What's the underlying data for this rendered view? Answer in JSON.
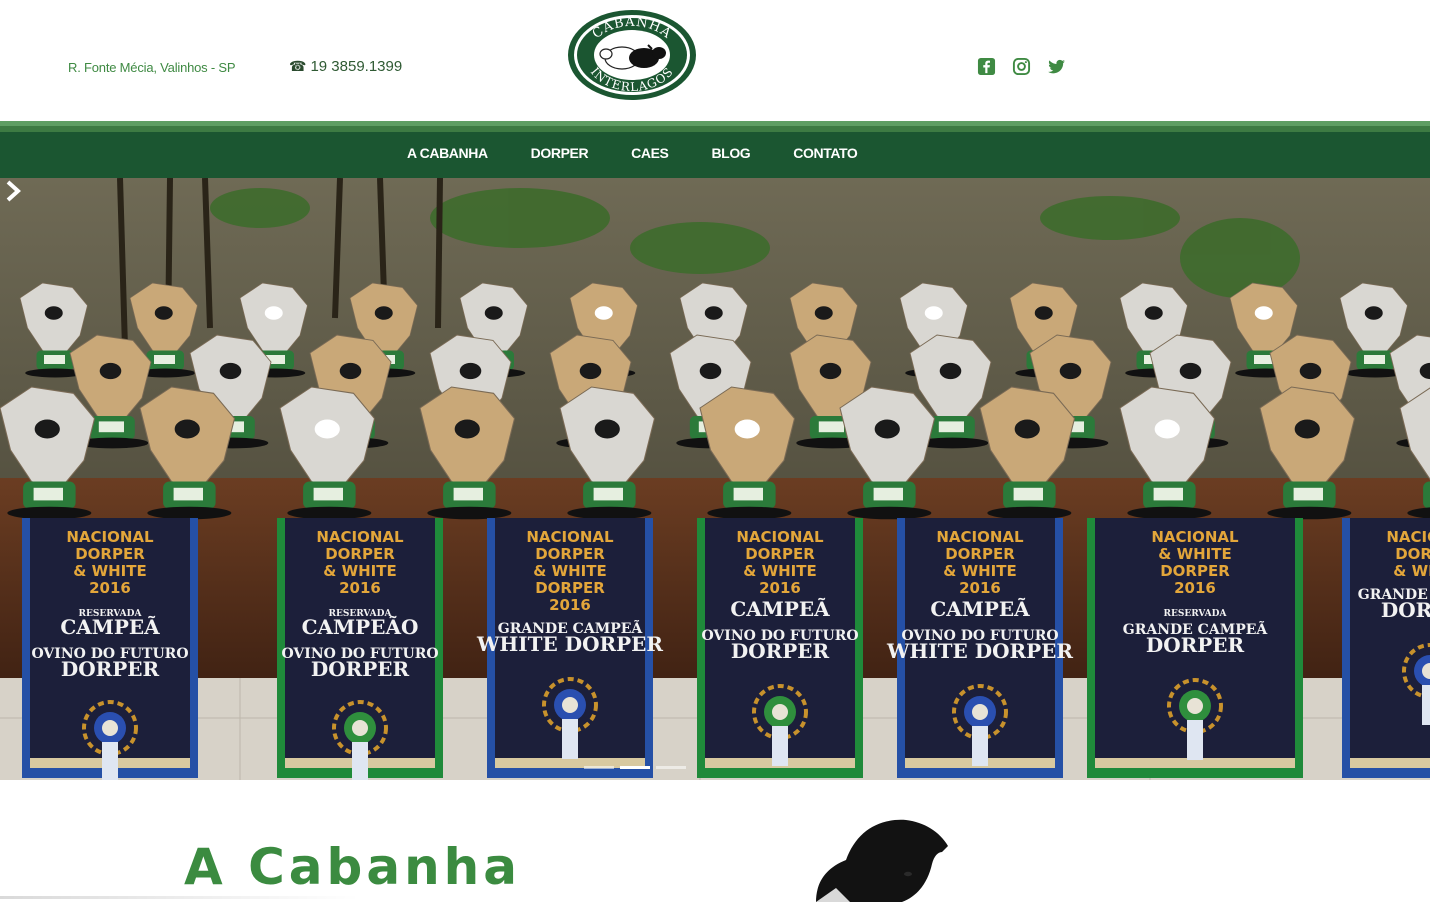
{
  "header": {
    "address": "R. Fonte Mécia, Valinhos - SP",
    "phone": "19 3859.1399",
    "phone_icon": "phone-icon",
    "logo": {
      "top_text": "CABANHA",
      "bottom_text": "INTERLAGOS"
    },
    "social": [
      "facebook-icon",
      "instagram-icon",
      "twitter-icon"
    ]
  },
  "nav": {
    "items": [
      {
        "label": "A CABANHA"
      },
      {
        "label": "DORPER"
      },
      {
        "label": "CAES"
      },
      {
        "label": "BLOG"
      },
      {
        "label": "CONTATO"
      }
    ]
  },
  "hero": {
    "slide_count": 3,
    "active_slide": 2,
    "sashes": [
      {
        "lines": [
          "NACIONAL",
          "DORPER",
          "& WHITE",
          "2016"
        ],
        "main": [
          "RESERVADA",
          "CAMPEÃ",
          "OVINO DO FUTURO",
          "DORPER"
        ]
      },
      {
        "lines": [
          "NACIONAL",
          "DORPER",
          "& WHITE",
          "2016"
        ],
        "main": [
          "RESERVADA",
          "CAMPEÃO",
          "OVINO DO FUTURO",
          "DORPER"
        ]
      },
      {
        "lines": [
          "NACIONAL",
          "DORPER",
          "& WHITE",
          "DORPER",
          "2016"
        ],
        "main": [
          "GRANDE CAMPEÃ",
          "WHITE DORPER"
        ]
      },
      {
        "lines": [
          "NACIONAL",
          "DORPER",
          "& WHITE",
          "2016"
        ],
        "main": [
          "CAMPEÃ",
          "OVINO DO FUTURO",
          "DORPER"
        ]
      },
      {
        "lines": [
          "NACIONAL",
          "DORPER",
          "& WHITE",
          "2016"
        ],
        "main": [
          "CAMPEÃ",
          "OVINO DO FUTURO",
          "WHITE DORPER"
        ]
      },
      {
        "lines": [
          "NACIONAL",
          "& WHITE",
          "DORPER",
          "2016"
        ],
        "main": [
          "RESERVADA",
          "GRANDE CAMPEÃ",
          "DORPER"
        ]
      },
      {
        "lines": [
          "NACIONAL",
          "DORPER",
          "& WHITE"
        ],
        "main": [
          "GRANDE CAMPEÃ",
          "DORPER"
        ]
      }
    ]
  },
  "section": {
    "title": "A Cabanha"
  },
  "colors": {
    "brand_green": "#1b5631",
    "accent_green": "#3b8b40",
    "sash_navy": "#1c1f3a",
    "sash_gold": "#e3a63a"
  }
}
